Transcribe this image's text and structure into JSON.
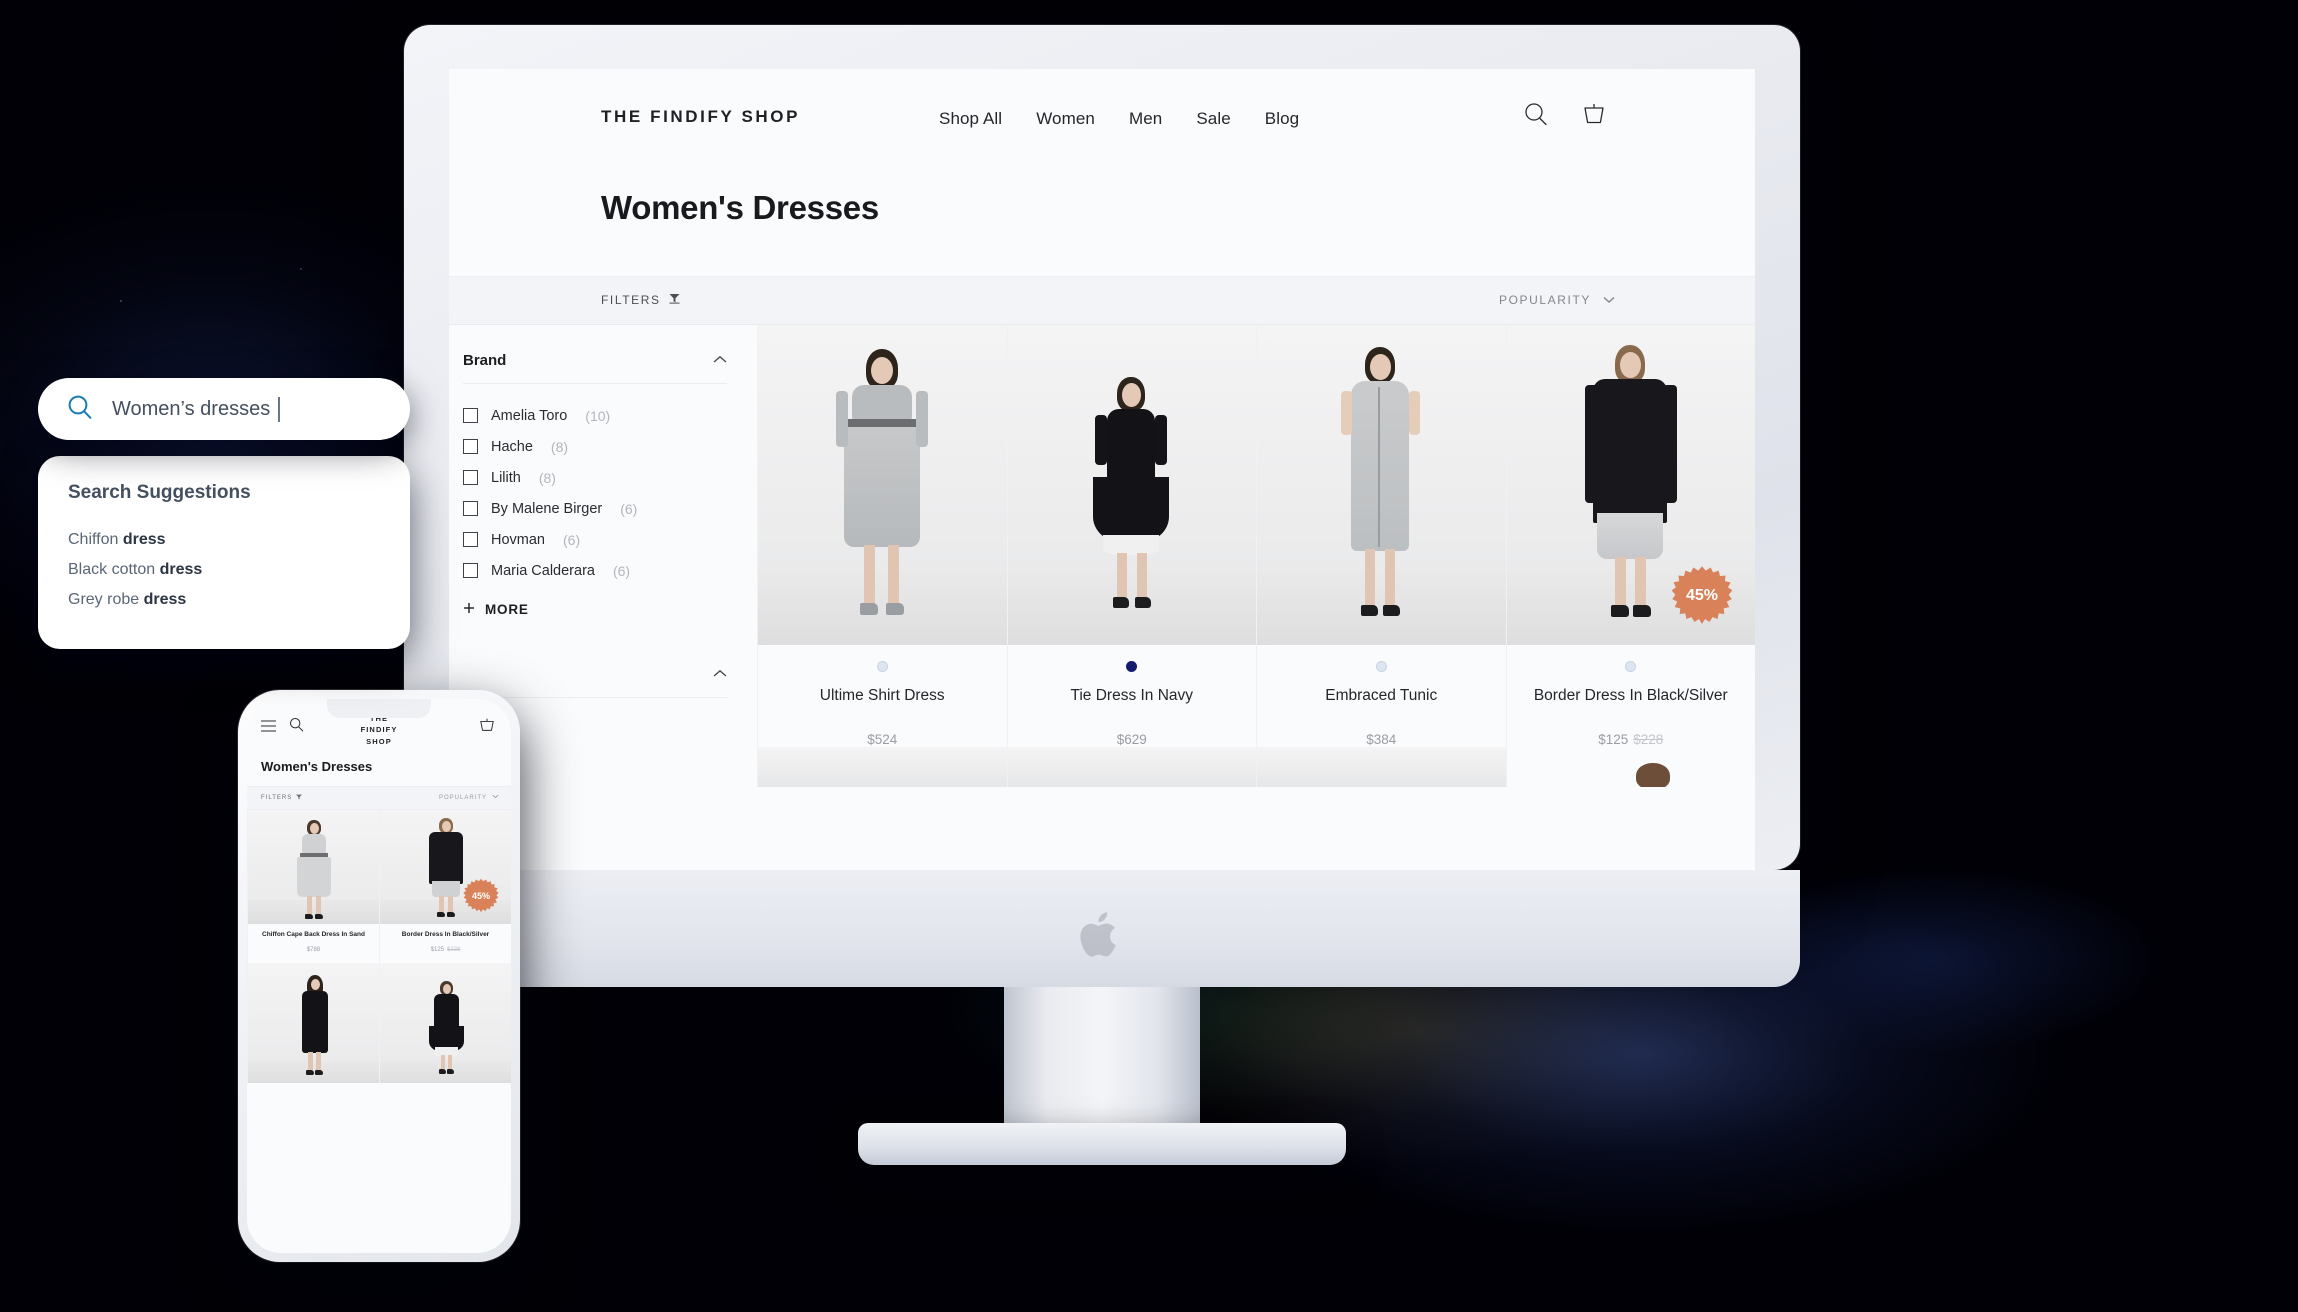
{
  "desktop": {
    "header": {
      "brand": "THE FINDIFY SHOP",
      "nav": [
        {
          "label": "Shop All"
        },
        {
          "label": "Women"
        },
        {
          "label": "Men"
        },
        {
          "label": "Sale"
        },
        {
          "label": "Blog"
        }
      ],
      "search_icon": "search-icon",
      "cart_icon": "cart-icon"
    },
    "page_title": "Women's Dresses",
    "filter_bar": {
      "filters_label": "FILTERS",
      "sort_label": "POPULARITY"
    },
    "facets": [
      {
        "title": "Brand",
        "expanded": true,
        "options": [
          {
            "label": "Amelia Toro",
            "count": "(10)"
          },
          {
            "label": "Hache",
            "count": "(8)"
          },
          {
            "label": "Lilith",
            "count": "(8)"
          },
          {
            "label": "By Malene Birger",
            "count": "(6)"
          },
          {
            "label": "Hovman",
            "count": "(6)"
          },
          {
            "label": "Maria Calderara",
            "count": "(6)"
          }
        ],
        "more_label": "MORE"
      }
    ],
    "products": [
      {
        "name": "Ultime Shirt Dress",
        "price": "$524",
        "old_price": "",
        "swatch": "#dce5f0",
        "badge": ""
      },
      {
        "name": "Tie Dress In Navy",
        "price": "$629",
        "old_price": "",
        "swatch": "#151c6e",
        "badge": ""
      },
      {
        "name": "Embraced Tunic",
        "price": "$384",
        "old_price": "",
        "swatch": "#dce5f0",
        "badge": ""
      },
      {
        "name": "Border Dress In Black/Silver",
        "price": "$125",
        "old_price": "$228",
        "swatch": "#dce5f0",
        "badge": "45%"
      }
    ]
  },
  "phone": {
    "brand_line1": "THE",
    "brand_line2": "FINDIFY",
    "brand_line3": "SHOP",
    "menu_icon": "hamburger-icon",
    "search_icon": "search-icon",
    "cart_icon": "cart-icon",
    "page_title": "Women's Dresses",
    "filters_label": "FILTERS",
    "sort_label": "POPULARITY",
    "products": [
      {
        "name": "Chiffon Cape Back Dress In Sand",
        "price": "$788",
        "old_price": "",
        "badge": ""
      },
      {
        "name": "Border Dress In Black/Silver",
        "price": "$125",
        "old_price": "$228",
        "badge": "45%"
      }
    ]
  },
  "search_overlay": {
    "search_icon": "search-icon",
    "query": "Women’s dresses",
    "suggestions_title": "Search Suggestions",
    "suggestions": [
      {
        "prefix": "Chiffon ",
        "match": "dress"
      },
      {
        "prefix": "Black cotton ",
        "match": "dress"
      },
      {
        "prefix": "Grey robe ",
        "match": "dress"
      }
    ]
  },
  "colors": {
    "badge": "#d9825a",
    "search_icon": "#1a7ab8",
    "navy_swatch": "#151c6e",
    "pale_swatch": "#dce5f0",
    "page_bg": "#000006"
  }
}
